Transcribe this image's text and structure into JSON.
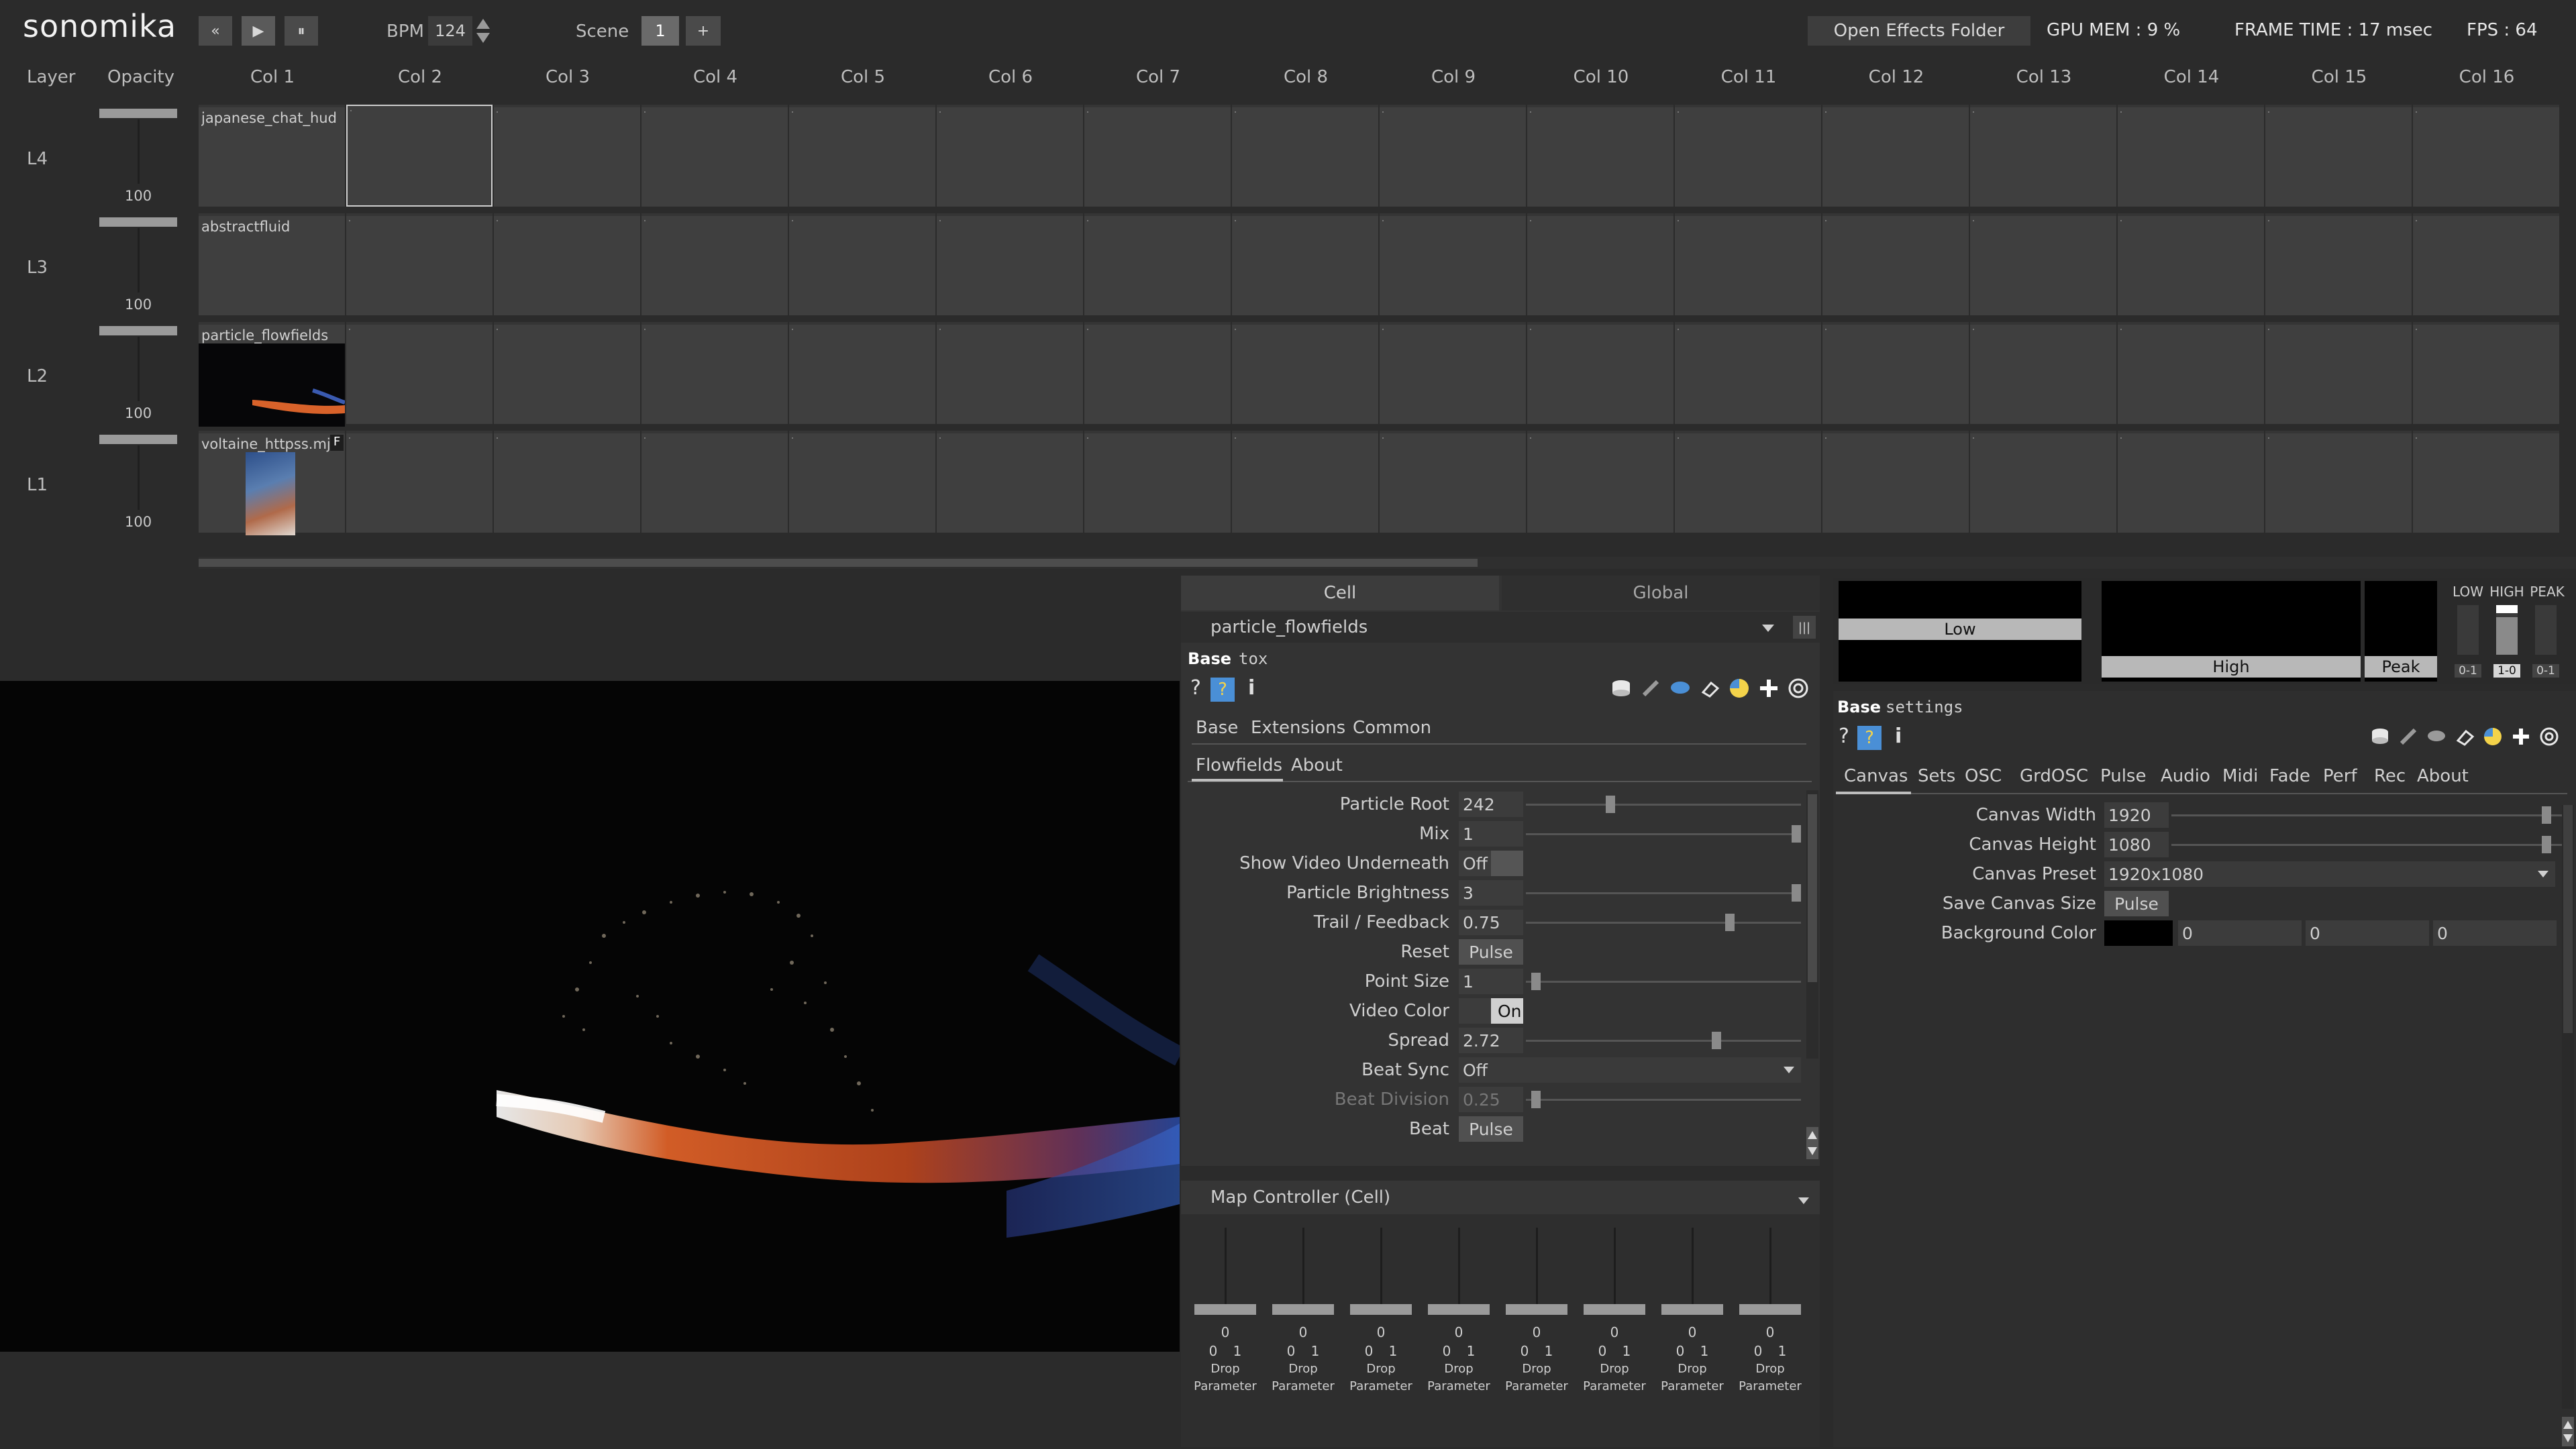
{
  "app": {
    "logo": "sonomika"
  },
  "transport": {
    "rewind": "«",
    "play": "▶",
    "pause": "⏸",
    "bpm_label": "BPM",
    "bpm_value": "124",
    "scene_label": "Scene",
    "scene_value": "1",
    "add": "+"
  },
  "status": {
    "open_effects": "Open Effects Folder",
    "gpu_mem": "GPU MEM : 9 %",
    "frame_time": "FRAME TIME : 17 msec",
    "fps": "FPS : 64"
  },
  "grid": {
    "layer_header": "Layer",
    "opacity_header": "Opacity",
    "columns": [
      "Col 1",
      "Col 2",
      "Col 3",
      "Col 4",
      "Col 5",
      "Col 6",
      "Col 7",
      "Col 8",
      "Col 9",
      "Col 10",
      "Col 11",
      "Col 12",
      "Col 13",
      "Col 14",
      "Col 15",
      "Col 16"
    ],
    "layers": [
      {
        "name": "L4",
        "opacity": "100",
        "clip": "japanese_chat_hud"
      },
      {
        "name": "L3",
        "opacity": "100",
        "clip": "abstractfluid"
      },
      {
        "name": "L2",
        "opacity": "100",
        "clip": "particle_flowfields"
      },
      {
        "name": "L1",
        "opacity": "100",
        "clip": "voltaine_httpss.mj",
        "badge": "F"
      }
    ]
  },
  "cell_panel": {
    "tabs": [
      "Cell",
      "Global"
    ],
    "selected": "particle_flowfields",
    "menu_icon": "|||",
    "base": "Base",
    "base_type": "tox",
    "subtabs": [
      "Base",
      "Extensions",
      "Common"
    ],
    "pages": [
      "Flowfields",
      "About"
    ],
    "params": [
      {
        "label": "Particle Root",
        "value": "242"
      },
      {
        "label": "Mix",
        "value": "1"
      },
      {
        "label": "Show Video Underneath",
        "value": "Off"
      },
      {
        "label": "Particle Brightness",
        "value": "3"
      },
      {
        "label": "Trail / Feedback",
        "value": "0.75"
      },
      {
        "label": "Reset",
        "value": "Pulse"
      },
      {
        "label": "Point Size",
        "value": "1"
      },
      {
        "label": "Video Color",
        "value": "On"
      },
      {
        "label": "Spread",
        "value": "2.72"
      },
      {
        "label": "Beat Sync",
        "value": "Off"
      },
      {
        "label": "Beat Division",
        "value": "0.25"
      },
      {
        "label": "Beat",
        "value": "Pulse"
      }
    ]
  },
  "map_controller": {
    "title": "Map Controller (Cell)",
    "fader_value": "0",
    "range_min": "0",
    "range_max": "1",
    "drop_line1": "Drop",
    "drop_line2": "Parameter",
    "count": 8
  },
  "audio": {
    "low": "Low",
    "high": "High",
    "peak": "Peak",
    "low_cap": "LOW",
    "high_cap": "HIGH",
    "peak_cap": "PEAK",
    "r1": "0-1",
    "r2": "1-0",
    "r3": "0-1"
  },
  "settings": {
    "base": "Base",
    "type": "settings",
    "tabs": [
      "Canvas",
      "Sets",
      "OSC",
      "GrdOSC",
      "Pulse",
      "Audio",
      "Midi",
      "Fade",
      "Perf",
      "Rec",
      "About"
    ],
    "canvas_width_label": "Canvas Width",
    "canvas_width": "1920",
    "canvas_height_label": "Canvas Height",
    "canvas_height": "1080",
    "canvas_preset_label": "Canvas Preset",
    "canvas_preset": "1920x1080",
    "save_label": "Save Canvas Size",
    "save_btn": "Pulse",
    "bg_label": "Background Color",
    "bg_r": "0",
    "bg_g": "0",
    "bg_b": "0"
  },
  "colors": {
    "accent_blue": "#4a8fd6",
    "panel": "#333333",
    "bg": "#2b2b2b"
  }
}
